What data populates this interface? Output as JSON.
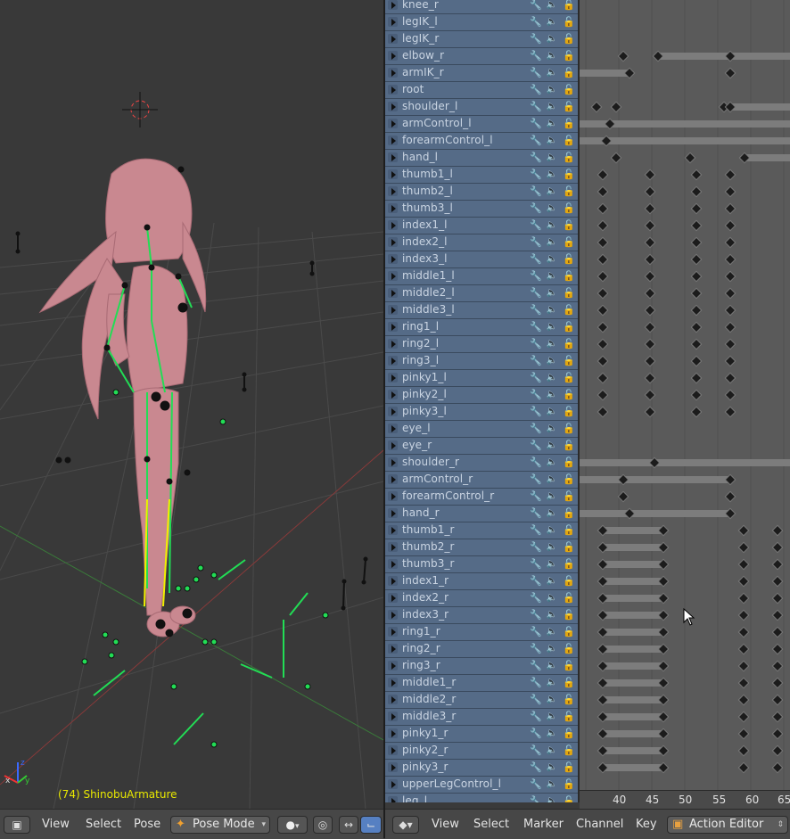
{
  "viewport": {
    "object_label": "(74) ShinobuArmature"
  },
  "channels": [
    "knee_r",
    "legIK_l",
    "legIK_r",
    "elbow_r",
    "armIK_r",
    "root",
    "shoulder_l",
    "armControl_l",
    "forearmControl_l",
    "hand_l",
    "thumb1_l",
    "thumb2_l",
    "thumb3_l",
    "index1_l",
    "index2_l",
    "index3_l",
    "middle1_l",
    "middle2_l",
    "middle3_l",
    "ring1_l",
    "ring2_l",
    "ring3_l",
    "pinky1_l",
    "pinky2_l",
    "pinky3_l",
    "eye_l",
    "eye_r",
    "shoulder_r",
    "armControl_r",
    "forearmControl_r",
    "hand_r",
    "thumb1_r",
    "thumb2_r",
    "thumb3_r",
    "index1_r",
    "index2_r",
    "index3_r",
    "ring1_r",
    "ring2_r",
    "ring3_r",
    "middle1_r",
    "middle2_r",
    "middle3_r",
    "pinky1_r",
    "pinky2_r",
    "pinky3_r",
    "upperLegControl_l",
    "leg_l"
  ],
  "ruler_ticks": [
    "40",
    "45",
    "50",
    "55",
    "60",
    "65"
  ],
  "header_left": {
    "menus": [
      "View",
      "Select",
      "Pose"
    ],
    "mode": "Pose Mode"
  },
  "header_right": {
    "menus": [
      "View",
      "Select",
      "Marker",
      "Channel",
      "Key"
    ],
    "editor_mode": "Action Editor"
  },
  "icons": {
    "wrench": "wrench-icon",
    "speaker": "speaker-icon",
    "lock": "lock-icon"
  },
  "colors": {
    "channel_bg": "#556b87",
    "bone_green": "#22dd55",
    "bone_yellow": "#f0f000",
    "model_pink": "#c98890",
    "label_yellow": "#e8e800"
  }
}
